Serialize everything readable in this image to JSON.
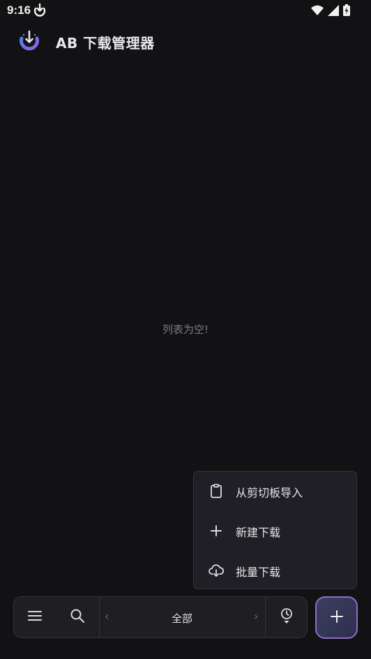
{
  "status_bar": {
    "time": "9:16",
    "icons": [
      "download-notification-icon",
      "wifi-icon",
      "signal-icon",
      "battery-charging-icon"
    ]
  },
  "app_bar": {
    "title": "AB 下载管理器",
    "logo": "app-logo-icon"
  },
  "main": {
    "empty_message": "列表为空!"
  },
  "add_menu": {
    "items": [
      {
        "label": "从剪切板导入",
        "icon": "clipboard-icon"
      },
      {
        "label": "新建下载",
        "icon": "plus-icon"
      },
      {
        "label": "批量下载",
        "icon": "cloud-download-icon"
      }
    ]
  },
  "bottom_bar": {
    "menu_icon": "hamburger-menu-icon",
    "search_icon": "search-icon",
    "filter_label": "全部",
    "prev_icon": "chevron-left-icon",
    "next_icon": "chevron-right-icon",
    "queue_icon": "clock-download-icon"
  },
  "fab": {
    "icon": "plus-icon"
  },
  "colors": {
    "background": "#121215",
    "surface": "#1f1f25",
    "accent_purple": "#8a6fc9",
    "logo_blue": "#4f7df0",
    "logo_purple": "#9b5de5"
  }
}
